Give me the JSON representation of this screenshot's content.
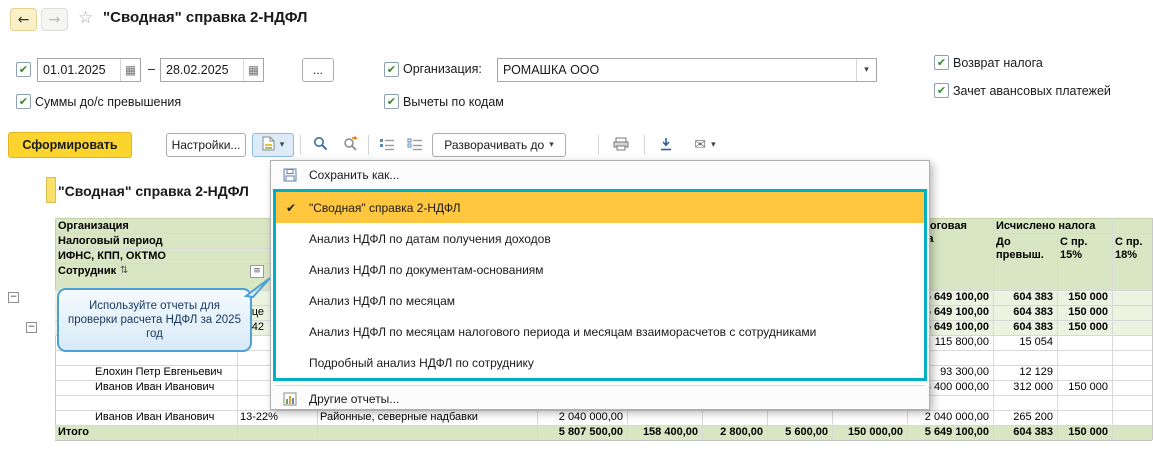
{
  "icons": {
    "back": "←",
    "forward": "→",
    "favorite": "☆",
    "check": "✔",
    "caret": "▾",
    "calendar": "▦",
    "minus": "−",
    "sort": "⇅",
    "header_menu": "≡",
    "mail": "✉"
  },
  "window": {
    "title": "\"Сводная\" справка 2-НДФЛ"
  },
  "filters": {
    "date_from": "01.01.2025",
    "dash": "–",
    "date_to": "28.02.2025",
    "more": "...",
    "org_label": "Организация:",
    "org_value": "РОМАШКА ООО",
    "cb_excess": "Суммы до/с превышения",
    "cb_codes": "Вычеты по кодам",
    "cb_refund": "Возврат налога",
    "cb_advance": "Зачет авансовых платежей"
  },
  "toolbar": {
    "generate": "Сформировать",
    "settings": "Настройки...",
    "expand_to": "Разворачивать до"
  },
  "variant_menu": {
    "save_as": "Сохранить как...",
    "variants": [
      "\"Сводная\" справка 2-НДФЛ",
      "Анализ НДФЛ по датам получения доходов",
      "Анализ НДФЛ по документам-основаниям",
      "Анализ НДФЛ по месяцам",
      "Анализ НДФЛ по месяцам налогового периода и месяцам взаиморасчетов с сотрудниками",
      "Подробный анализ НДФЛ по сотруднику"
    ],
    "other_reports": "Другие отчеты..."
  },
  "callout": {
    "text": "Используйте отчеты для проверки расчета НДФЛ за 2025 год"
  },
  "report": {
    "title": "\"Сводная\" справка 2-НДФЛ",
    "header": {
      "org": "Организация",
      "period": "Налоговый период",
      "ifns": "ИФНС, КПП, ОКТМО",
      "employee": "Сотрудник",
      "tax_base": "Налоговая база",
      "calc": "Исчислено налога",
      "calc_before": "До превыш.",
      "calc_15": "С пр. 15%",
      "calc_18": "С пр. 18%"
    },
    "rows": [
      {
        "base": "5 649 100,00",
        "before": "604 383",
        "r15": "150 000"
      },
      {
        "frag": "це",
        "base": "5 649 100,00",
        "before": "604 383",
        "r15": "150 000"
      },
      {
        "frag": "842",
        "base": "5 649 100,00",
        "before": "604 383",
        "r15": "150 000"
      },
      {
        "base": "115 800,00",
        "before": "15 054"
      },
      {},
      {
        "name": "Елохин Петр Евгеньевич",
        "base": "93 300,00",
        "before": "12 129"
      },
      {
        "name": "Иванов Иван Иванович",
        "base": "3 400 000,00",
        "before": "312 000",
        "r15": "150 000"
      },
      {},
      {
        "name": "Иванов Иван Иванович",
        "rate": "13-22%",
        "income_type": "Районные, северные надбавки",
        "income": "2 040 000,00",
        "base": "2 040 000,00",
        "before": "265 200"
      }
    ],
    "total": {
      "label": "Итого",
      "income": "5 807 500,00",
      "d1": "158 400,00",
      "d2": "2 800,00",
      "d3": "5 600,00",
      "d4": "150 000,00",
      "base": "5 649 100,00",
      "before": "604 383",
      "r15": "150 000"
    }
  },
  "colors": {
    "accent_yellow": "#FCD42E",
    "menu_highlight": "#FFC640",
    "variant_frame_teal": "#00AFC4",
    "header_green": "#D9E6C3",
    "group_row_green": "#EDF3E1",
    "callout_blue": "#4D9FD6"
  }
}
